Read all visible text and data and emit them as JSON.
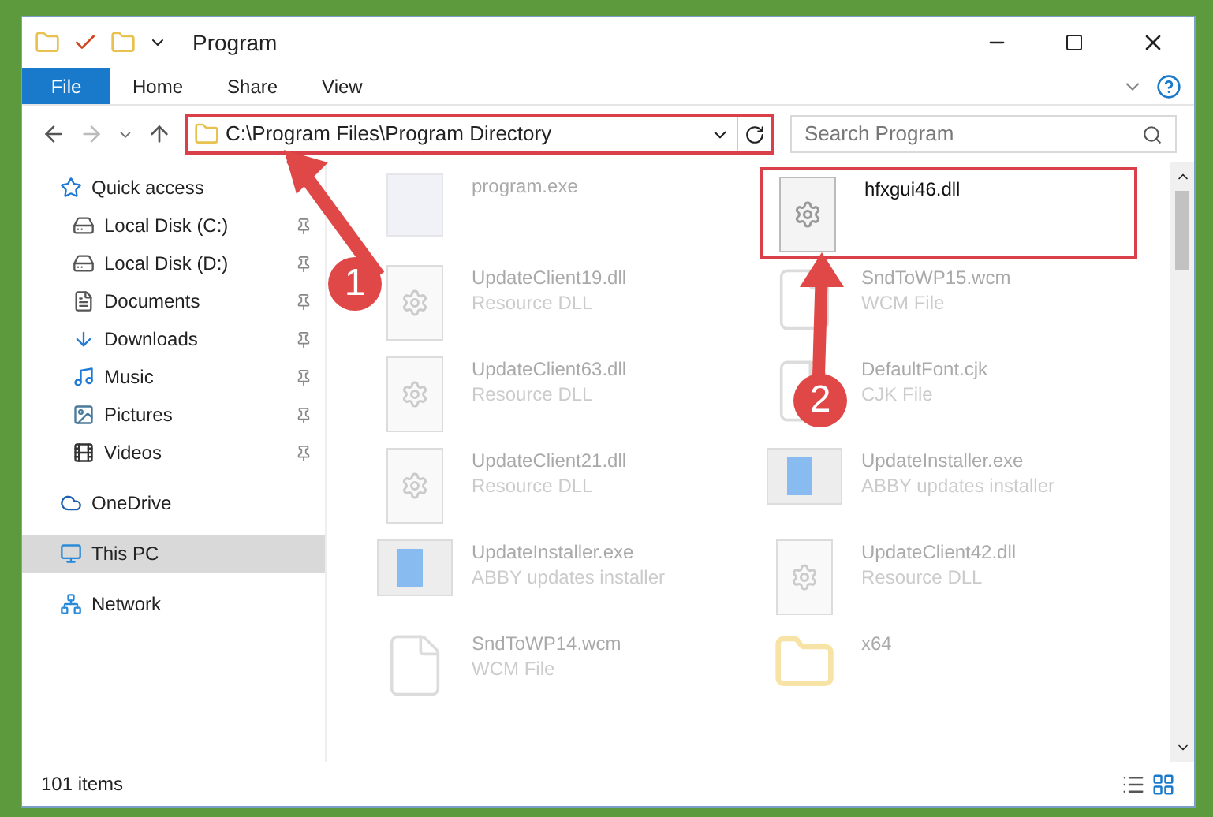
{
  "window": {
    "title": "Program"
  },
  "ribbon_tabs": [
    {
      "label": "File",
      "selected": true
    },
    {
      "label": "Home",
      "selected": false
    },
    {
      "label": "Share",
      "selected": false
    },
    {
      "label": "View",
      "selected": false
    }
  ],
  "address_bar": {
    "path": "C:\\Program Files\\Program Directory",
    "highlighted": true
  },
  "search": {
    "placeholder": "Search Program"
  },
  "sidebar": {
    "items": [
      {
        "label": "Quick access",
        "kind": "star",
        "pinned": false,
        "selected": false,
        "children": [
          {
            "label": "Local Disk (C:)",
            "kind": "disk",
            "pinned": true,
            "selected": false
          },
          {
            "label": "Local Disk (D:)",
            "kind": "disk",
            "pinned": true,
            "selected": false
          },
          {
            "label": "Documents",
            "kind": "document",
            "pinned": true,
            "selected": false
          },
          {
            "label": "Downloads",
            "kind": "download",
            "pinned": true,
            "selected": false
          },
          {
            "label": "Music",
            "kind": "music",
            "pinned": true,
            "selected": false
          },
          {
            "label": "Pictures",
            "kind": "picture",
            "pinned": true,
            "selected": false
          },
          {
            "label": "Videos",
            "kind": "video",
            "pinned": true,
            "selected": false
          }
        ]
      },
      {
        "label": "OneDrive",
        "kind": "cloud",
        "pinned": false,
        "selected": false
      },
      {
        "label": "This PC",
        "kind": "pc",
        "pinned": false,
        "selected": true
      },
      {
        "label": "Network",
        "kind": "network",
        "pinned": false,
        "selected": false
      }
    ]
  },
  "files": [
    {
      "name": "program.exe",
      "kind": "app",
      "highlighted": false
    },
    {
      "name": "hfxgui46.dll",
      "kind": "dll",
      "highlighted": true
    },
    {
      "name": "UpdateClient19.dll",
      "type": "Resource DLL",
      "kind": "dll",
      "highlighted": false
    },
    {
      "name": "SndToWP15.wcm",
      "type": "WCM File",
      "kind": "file",
      "highlighted": false
    },
    {
      "name": "UpdateClient63.dll",
      "type": "Resource DLL",
      "kind": "dll",
      "highlighted": false
    },
    {
      "name": "DefaultFont.cjk",
      "type": "CJK File",
      "kind": "file",
      "highlighted": false
    },
    {
      "name": "UpdateClient21.dll",
      "type": "Resource DLL",
      "kind": "dll",
      "highlighted": false
    },
    {
      "name": "UpdateInstaller.exe",
      "type": "ABBY updates installer",
      "kind": "installer",
      "highlighted": false
    },
    {
      "name": "UpdateInstaller.exe",
      "type": "ABBY updates installer",
      "kind": "installer",
      "highlighted": false
    },
    {
      "name": "UpdateClient42.dll",
      "type": "Resource DLL",
      "kind": "dll",
      "highlighted": false
    },
    {
      "name": "SndToWP14.wcm",
      "type": "WCM File",
      "kind": "file",
      "highlighted": false
    },
    {
      "name": "x64",
      "kind": "folder",
      "highlighted": false
    }
  ],
  "callouts": [
    "1",
    "2"
  ],
  "status_bar": {
    "item_count": "101 items"
  }
}
